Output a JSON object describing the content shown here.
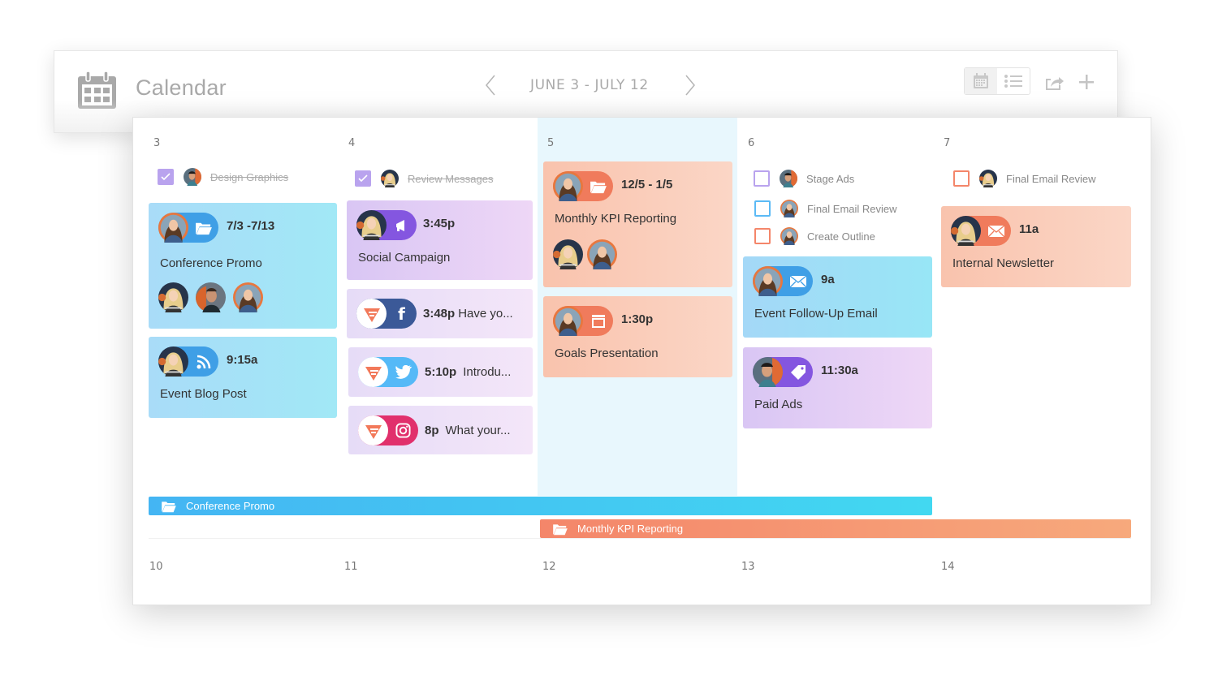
{
  "header": {
    "app_title": "Calendar",
    "app_icon": "calendar-icon",
    "date_range": "JUNE 3 - JULY 12",
    "prev_icon": "chevron-left-icon",
    "next_icon": "chevron-right-icon",
    "view_toggle": [
      {
        "icon": "calendar-view-icon",
        "active": true
      },
      {
        "icon": "list-view-icon",
        "active": false
      }
    ],
    "share_icon": "share-icon",
    "add_icon": "plus-icon"
  },
  "colors": {
    "today_column": "#e8f7fd",
    "blue": "#44b5f3",
    "purple": "#8456e0",
    "orange": "#f4866a",
    "facebook": "#3b5998",
    "twitter": "#55b9f7",
    "instagram": "#e1306c",
    "checkbox_done": "#b9a3ee"
  },
  "week1": {
    "days": [
      {
        "number": "3",
        "tasks": [
          {
            "label": "Design Graphics",
            "done": true,
            "checkbox_color": "#b9a3ee"
          }
        ],
        "cards": [
          {
            "type_icon": "folder-icon",
            "time": "7/3 -7/13",
            "title": "Conference Promo",
            "assignees": 3,
            "color": "blue"
          },
          {
            "type_icon": "rss-icon",
            "time": "9:15a",
            "title": "Event Blog Post",
            "color": "blue"
          }
        ]
      },
      {
        "number": "4",
        "tasks": [
          {
            "label": "Review Messages",
            "done": true,
            "checkbox_color": "#b9a3ee"
          }
        ],
        "cards": [
          {
            "type_icon": "megaphone-icon",
            "time": "3:45p",
            "title": "Social Campaign",
            "color": "purple"
          },
          {
            "type_icon": "facebook-icon",
            "time": "3:48p",
            "snippet": "Have yo...",
            "color": "light-purple"
          },
          {
            "type_icon": "twitter-icon",
            "time": "5:10p",
            "snippet": "Introdu...",
            "color": "light-purple"
          },
          {
            "type_icon": "instagram-icon",
            "time": "8p",
            "snippet": "What your...",
            "color": "light-purple"
          }
        ]
      },
      {
        "number": "5",
        "is_today": true,
        "tasks": [],
        "cards": [
          {
            "type_icon": "folder-icon",
            "time": "12/5 - 1/5",
            "title": "Monthly KPI Reporting",
            "assignees": 2,
            "color": "salmon"
          },
          {
            "type_icon": "presentation-icon",
            "time": "1:30p",
            "title": "Goals Presentation",
            "color": "salmon"
          }
        ]
      },
      {
        "number": "6",
        "tasks": [
          {
            "label": "Stage Ads",
            "done": false,
            "checkbox_color": "#b9a3ee"
          },
          {
            "label": "Final Email Review",
            "done": false,
            "checkbox_color": "#5bbaf5"
          },
          {
            "label": "Create Outline",
            "done": false,
            "checkbox_color": "#f4866a"
          }
        ],
        "cards": [
          {
            "type_icon": "email-icon",
            "time": "9a",
            "title": "Event Follow-Up Email",
            "color": "blue"
          },
          {
            "type_icon": "tag-icon",
            "time": "11:30a",
            "title": "Paid Ads",
            "color": "purple"
          }
        ]
      },
      {
        "number": "7",
        "tasks": [
          {
            "label": "Final Email Review",
            "done": false,
            "checkbox_color": "#f4866a"
          }
        ],
        "cards": [
          {
            "type_icon": "email-icon",
            "time": "11a",
            "title": "Internal Newsletter",
            "color": "salmon"
          }
        ]
      }
    ],
    "span_bars": [
      {
        "label": "Conference Promo",
        "icon": "folder-icon",
        "color": "blue",
        "start_day": "3",
        "end_day": "6"
      },
      {
        "label": "Monthly KPI Reporting",
        "icon": "folder-icon",
        "color": "orange",
        "start_day": "5",
        "end_day": "7"
      }
    ]
  },
  "week2": {
    "days": [
      {
        "number": "10"
      },
      {
        "number": "11"
      },
      {
        "number": "12"
      },
      {
        "number": "13"
      },
      {
        "number": "14"
      }
    ]
  }
}
